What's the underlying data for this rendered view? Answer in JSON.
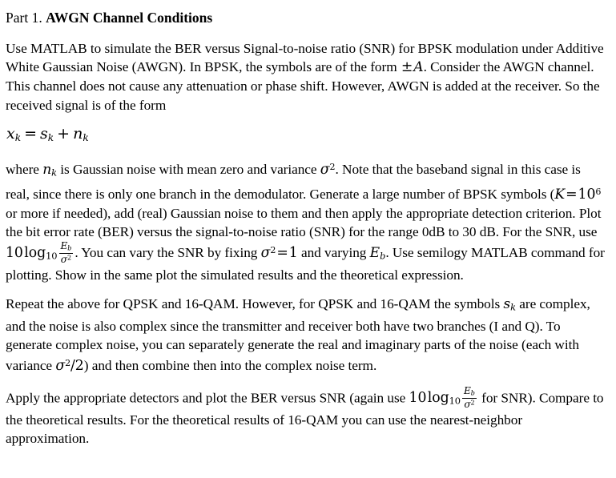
{
  "document": {
    "heading": {
      "lead": "Part 1.",
      "title": "AWGN Channel Conditions"
    },
    "paragraph1": {
      "seg1": "Use MATLAB to simulate the BER versus Signal-to-noise ratio (SNR) for BPSK modulation under Additive White Gaussian Noise (AWGN). In BPSK, the symbols are of the form ",
      "pm": "±",
      "amp": "A",
      "seg2": ". Consider the AWGN channel. This channel does not cause any attenuation or phase shift. However, AWGN is added at the receiver. So the received signal is of the form"
    },
    "equation": {
      "x": "x",
      "sub_k1": "k",
      "eq": "=",
      "s": "s",
      "sub_k2": "k",
      "plus": "+",
      "n": "n",
      "sub_k3": "k",
      "plain": "x_k = s_k + n_k"
    },
    "paragraph2": {
      "seg1": "where ",
      "n": "n",
      "sub_k": "k",
      "seg2": " is Gaussian noise with mean zero and variance ",
      "sigma": "σ",
      "sup2a": "2",
      "seg3": ". Note that the baseband signal in this case is real, since there is only one branch in the demodulator. Generate a large number of BPSK symbols (",
      "K": "K",
      "eq": "=",
      "ten": "10",
      "sup6": "6",
      "seg4": " or more if needed), add (real) Gaussian noise to them and then apply the appropriate detection criterion. Plot the bit error rate (BER) versus the signal-to-noise ratio (SNR) for the range 0dB to 30 dB. For the SNR, use ",
      "ten10": "10",
      "log": "log",
      "log_sub": "10",
      "frac_num_E": "E",
      "frac_num_sub": "b",
      "frac_den_sigma": "σ",
      "frac_den_sup": "2",
      "seg5": ". You can vary the SNR by fixing ",
      "sigma2": "σ",
      "sup2b": "2",
      "eq2": "=",
      "one": "1",
      "seg6": " and varying ",
      "Eb_E": "E",
      "Eb_sub": "b",
      "seg7": ". Use semilogy MATLAB command for plotting. Show in the same plot the simulated results and the theoretical expression."
    },
    "paragraph3": {
      "seg1": "Repeat the above for QPSK and 16-QAM. However, for QPSK and 16-QAM the symbols ",
      "s": "s",
      "sub_k": "k",
      "seg2": " are complex, and the noise is also complex since the transmitter and receiver both have two branches (I and Q). To generate complex noise, you can separately generate the real and imaginary parts of the noise (each with variance ",
      "sigma": "σ",
      "sup2": "2",
      "slash2": "/2",
      "seg3": ") and then combine then into the complex noise term."
    },
    "paragraph4": {
      "seg1": "Apply the appropriate detectors and plot the BER versus SNR (again use ",
      "ten10": "10",
      "log": "log",
      "log_sub": "10",
      "frac_num_E": "E",
      "frac_num_sub": "b",
      "frac_den_sigma": "σ",
      "frac_den_sup": "2",
      "seg2": " for SNR). Compare to the theoretical results. For the theoretical results of 16-QAM you can use the nearest-neighbor approximation."
    }
  },
  "style": {
    "background": "#ffffff",
    "text_color": "#000000"
  }
}
